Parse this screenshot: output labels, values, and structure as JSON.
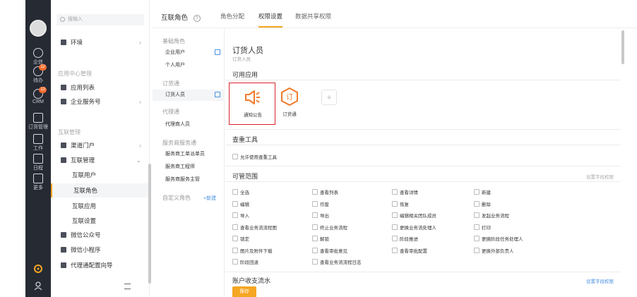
{
  "rail": {
    "items": [
      {
        "label": "企信",
        "icon": "chat-icon"
      },
      {
        "label": "待办",
        "icon": "todo-icon",
        "badge": "12"
      },
      {
        "label": "CRM",
        "icon": "crm-icon",
        "badge": "13"
      },
      {
        "label": "订货管理",
        "icon": "order-icon"
      },
      {
        "label": "工作",
        "icon": "work-icon"
      },
      {
        "label": "日程",
        "icon": "calendar-icon"
      },
      {
        "label": "更多",
        "icon": "more-icon"
      }
    ]
  },
  "sidebar": {
    "search_placeholder": "搜输入",
    "items": [
      {
        "label": "环境",
        "arrow": "›"
      },
      {
        "group": "应用中心管理"
      },
      {
        "label": "应用列表"
      },
      {
        "label": "企业服务号",
        "arrow": "›"
      },
      {
        "group": "互联管理"
      },
      {
        "label": "渠道门户",
        "arrow": "›"
      },
      {
        "label": "互联管理",
        "arrow": "⌄"
      },
      {
        "label": "互联用户"
      },
      {
        "label": "互联角色"
      },
      {
        "label": "互联应用"
      },
      {
        "label": "互联设置"
      },
      {
        "label": "微信公众号"
      },
      {
        "label": "微信小程序"
      },
      {
        "label": "代理通配置向导"
      }
    ]
  },
  "tabs": {
    "title": "互联角色",
    "help": "?",
    "items": [
      "角色分配",
      "权限设置",
      "数据共享权限"
    ],
    "active_index": 1
  },
  "roles": {
    "groups": [
      {
        "name": "基础角色",
        "items": [
          "企业用户",
          "个人用户"
        ]
      },
      {
        "name": "订货通",
        "items": [
          "订货人员"
        ]
      },
      {
        "name": "代理通",
        "items": [
          "代理商人员"
        ]
      },
      {
        "name": "服务商服务通",
        "items": [
          "服务商工单派单员",
          "服务商工程师",
          "服务商服务主管"
        ]
      },
      {
        "name": "自定义角色",
        "items": []
      }
    ],
    "new_label": "+新建",
    "active": "订货人员"
  },
  "main": {
    "title": "订货人员",
    "subtitle": "订货人员",
    "apps_section": "可用应用",
    "apps": [
      {
        "label": "通知公告",
        "icon": "megaphone-icon"
      },
      {
        "label": "订货通",
        "icon": "order-hex-icon"
      }
    ],
    "add_label": "+",
    "tools_section": "查重工具",
    "tools_checkbox": "允许使用查重工具",
    "scope_section": "可管范围",
    "scope_link": "设置字段权限",
    "permissions": [
      [
        "全选",
        "查看列表",
        "查看详情",
        "新建"
      ],
      [
        "编辑",
        "作废",
        "恢复",
        "删除"
      ],
      [
        "导入",
        "导出",
        "编辑相关团队成员",
        "发起业务流程"
      ],
      [
        "查看业务流流程图",
        "终止业务流程",
        "更换业务流处理人",
        "打印"
      ],
      [
        "锁定",
        "解锁",
        "阶段推进",
        "更换阶段任务处理人"
      ],
      [
        "图片及附件下载",
        "查看审批意见",
        "查看审批配置",
        "更换外部负责人"
      ],
      [
        "阶段回退",
        "查看业务流流程日志",
        "",
        ""
      ]
    ],
    "account_section": "账户收支流水",
    "account_link": "设置字段权限",
    "save_label": "保存"
  },
  "colors": {
    "accent": "#f5a623",
    "rail": "#262a33",
    "selected_border": "#d9232e",
    "link": "#4a90e2"
  }
}
